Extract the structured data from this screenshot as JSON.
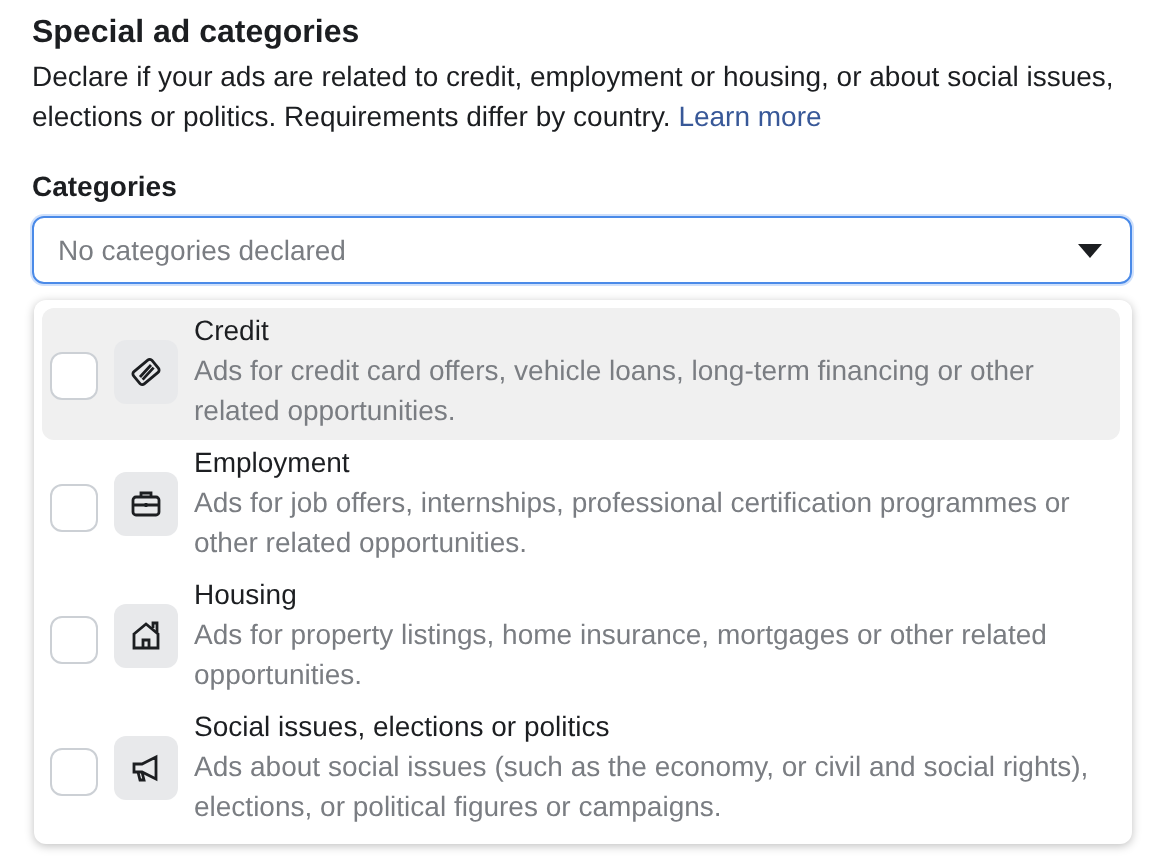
{
  "heading": "Special ad categories",
  "description": "Declare if your ads are related to credit, employment or housing, or about social issues, elections or politics. Requirements differ by country.",
  "learn_more": "Learn more",
  "categories_label": "Categories",
  "select": {
    "placeholder": "No categories declared",
    "expanded": true
  },
  "options": [
    {
      "kind": "card",
      "title": "Credit",
      "description": "Ads for credit card offers, vehicle loans, long-term financing or other related opportunities.",
      "checked": false,
      "highlighted": true
    },
    {
      "kind": "briefcase",
      "title": "Employment",
      "description": "Ads for job offers, internships, professional certification programmes or other related opportunities.",
      "checked": false,
      "highlighted": false
    },
    {
      "kind": "house",
      "title": "Housing",
      "description": "Ads for property listings, home insurance, mortgages or other related opportunities.",
      "checked": false,
      "highlighted": false
    },
    {
      "kind": "megaphone",
      "title": "Social issues, elections or politics",
      "description": "Ads about social issues (such as the economy, or civil and social rights), elections, or political figures or campaigns.",
      "checked": false,
      "highlighted": false
    }
  ]
}
